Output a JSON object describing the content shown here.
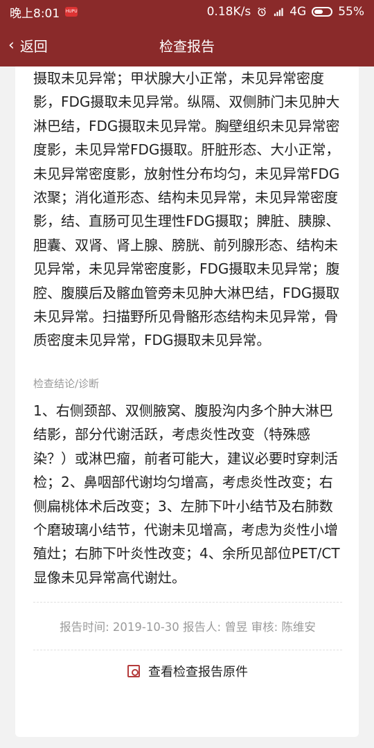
{
  "status_bar": {
    "time": "晚上8:01",
    "app_badge": "HUPU",
    "network_speed": "0.18K/s",
    "network_type": "4G",
    "battery_percent": "55%"
  },
  "nav": {
    "back_label": "返回",
    "title": "检查报告"
  },
  "report": {
    "findings_text": "摄取未见异常；甲状腺大小正常，未见异常密度影，FDG摄取未见异常。纵隔、双侧肺门未见肿大淋巴结，FDG摄取未见异常。胸壁组织未见异常密度影，未见异常FDG摄取。肝脏形态、大小正常，未见异常密度影，放射性分布均匀，未见异常FDG浓聚；消化道形态、结构未见异常，未见异常密度影，结、直肠可见生理性FDG摄取；脾脏、胰腺、胆囊、双肾、肾上腺、膀胱、前列腺形态、结构未见异常，未见异常密度影，FDG摄取未见异常；腹腔、腹膜后及髂血管旁未见肿大淋巴结，FDG摄取未见异常。扫描野所见骨骼形态结构未见异常，骨质密度未见异常，FDG摄取未见异常。",
    "conclusion_label": "检查结论/诊断",
    "conclusion_text": "1、右侧颈部、双侧腋窝、腹股沟内多个肿大淋巴结影，部分代谢活跃，考虑炎性改变（特殊感染？）或淋巴瘤，前者可能大，建议必要时穿刺活检；2、鼻咽部代谢均匀增高，考虑炎性改变；右侧扁桃体术后改变；3、左肺下叶小结节及右肺数个磨玻璃小结节，代谢未见增高，考虑为炎性小增殖灶；右肺下叶炎性改变；4、余所见部位PET/CT显像未见异常高代谢灶。",
    "meta_text": "报告时间: 2019-10-30 报告人: 曾昱 审核: 陈维安",
    "view_original_label": "查看检查报告原件"
  },
  "colors": {
    "primary": "#8a2a2a",
    "icon_accent": "#b43a3a",
    "muted_text": "#9a9a9a",
    "body_text": "#222222"
  },
  "icons": {
    "back": "chevron-left-icon",
    "alarm": "alarm-icon",
    "signal": "signal-icon",
    "battery": "battery-icon",
    "document": "document-search-icon"
  }
}
